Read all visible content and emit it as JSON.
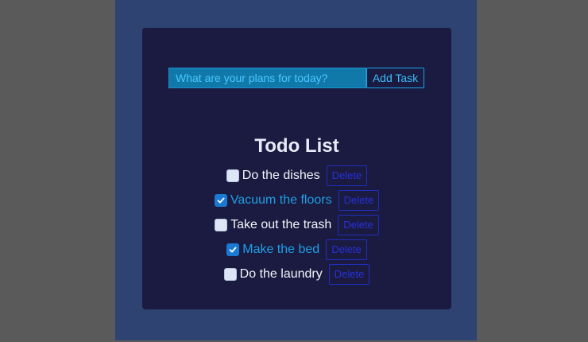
{
  "form": {
    "input_value": "",
    "input_placeholder": "What are your plans for today?",
    "add_label": "Add Task"
  },
  "title": "Todo List",
  "todos": [
    {
      "text": "Do the dishes",
      "done": false,
      "delete_label": "Delete"
    },
    {
      "text": "Vacuum the floors",
      "done": true,
      "delete_label": "Delete"
    },
    {
      "text": "Take out the trash",
      "done": false,
      "delete_label": "Delete"
    },
    {
      "text": "Make the bed",
      "done": true,
      "delete_label": "Delete"
    },
    {
      "text": "Do the laundry",
      "done": false,
      "delete_label": "Delete"
    }
  ],
  "colors": {
    "page_background": "#5a5a5a",
    "frame_background": "#2e4371",
    "card_background": "#1b1a40",
    "input_background": "#1179aa",
    "accent": "#38bdf8",
    "done_text": "#1da0e6",
    "delete_text": "#2631dd"
  }
}
